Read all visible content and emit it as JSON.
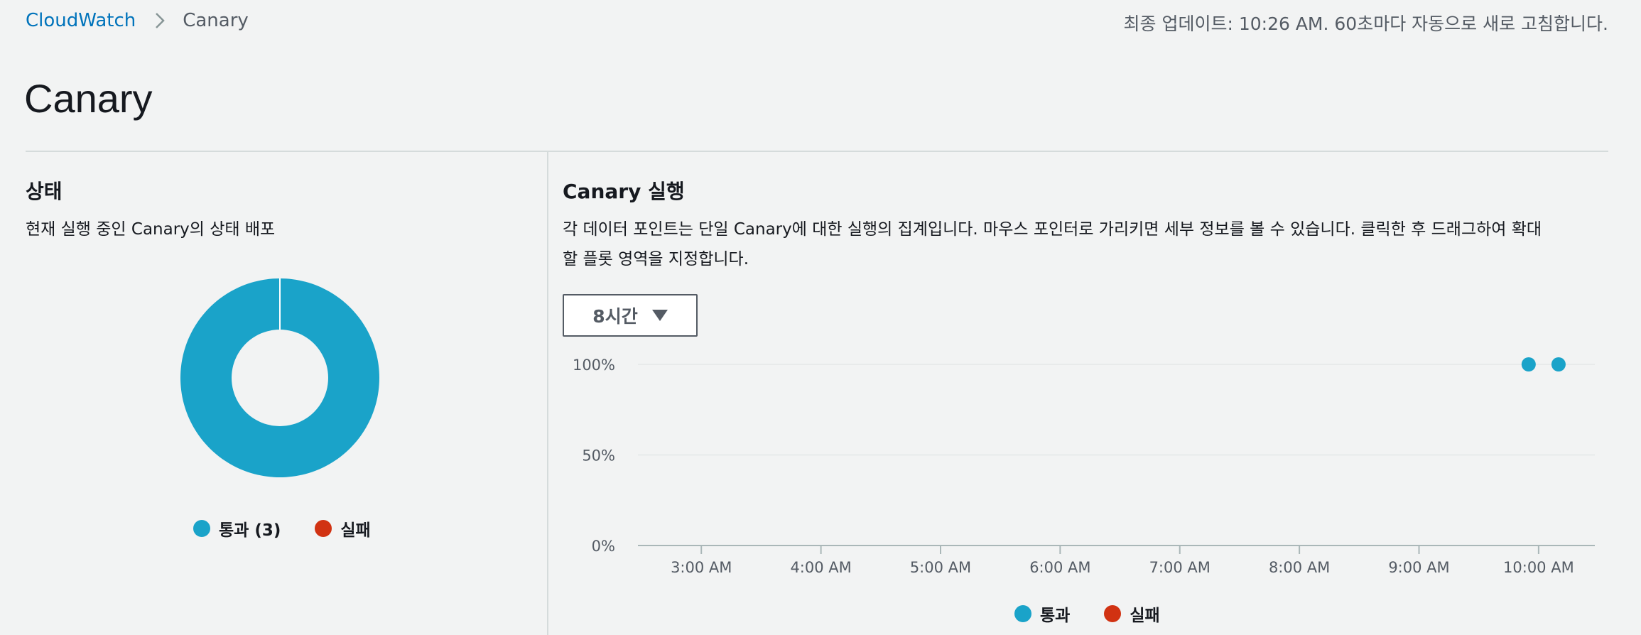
{
  "breadcrumb": {
    "root": "CloudWatch",
    "current": "Canary"
  },
  "last_updated": "최종 업데이트: 10:26 AM. 60초마다 자동으로 새로 고침합니다.",
  "page_title": "Canary",
  "status_panel": {
    "heading": "상태",
    "description": "현재 실행 중인 Canary의 상태 배포",
    "legend": [
      {
        "label": "통과 (3)",
        "color": "#1aa3c9"
      },
      {
        "label": "실패",
        "color": "#d13212"
      }
    ]
  },
  "runs_panel": {
    "heading": "Canary 실행",
    "description_line1": "각 데이터 포인트는 단일 Canary에 대한 실행의 집계입니다. 마우스 포인터로 가리키면 세부 정보를 볼 수 있습니다. 클릭한 후 드래그하여 확대",
    "description_line2": "할 플롯 영역을 지정합니다.",
    "time_range": "8시간",
    "legend": [
      {
        "label": "통과",
        "color": "#1aa3c9"
      },
      {
        "label": "실패",
        "color": "#d13212"
      }
    ]
  },
  "chart_data": [
    {
      "type": "pie",
      "categories": [
        "통과",
        "실패"
      ],
      "values": [
        3,
        0
      ],
      "colors": [
        "#1aa3c9",
        "#d13212"
      ]
    },
    {
      "type": "scatter",
      "x_ticks": [
        "3:00 AM",
        "4:00 AM",
        "5:00 AM",
        "6:00 AM",
        "7:00 AM",
        "8:00 AM",
        "9:00 AM",
        "10:00 AM"
      ],
      "y_ticks": [
        "100%",
        "50%",
        "0%"
      ],
      "ylim": [
        0,
        100
      ],
      "xlim_hours": [
        2.47,
        10.47
      ],
      "series": [
        {
          "name": "통과",
          "color": "#1aa3c9",
          "x": [
            "9:55 AM",
            "10:10 AM"
          ],
          "y": [
            100,
            100
          ]
        },
        {
          "name": "실패",
          "color": "#d13212",
          "x": [],
          "y": []
        }
      ],
      "grid": true,
      "legend_position": "bottom"
    }
  ]
}
